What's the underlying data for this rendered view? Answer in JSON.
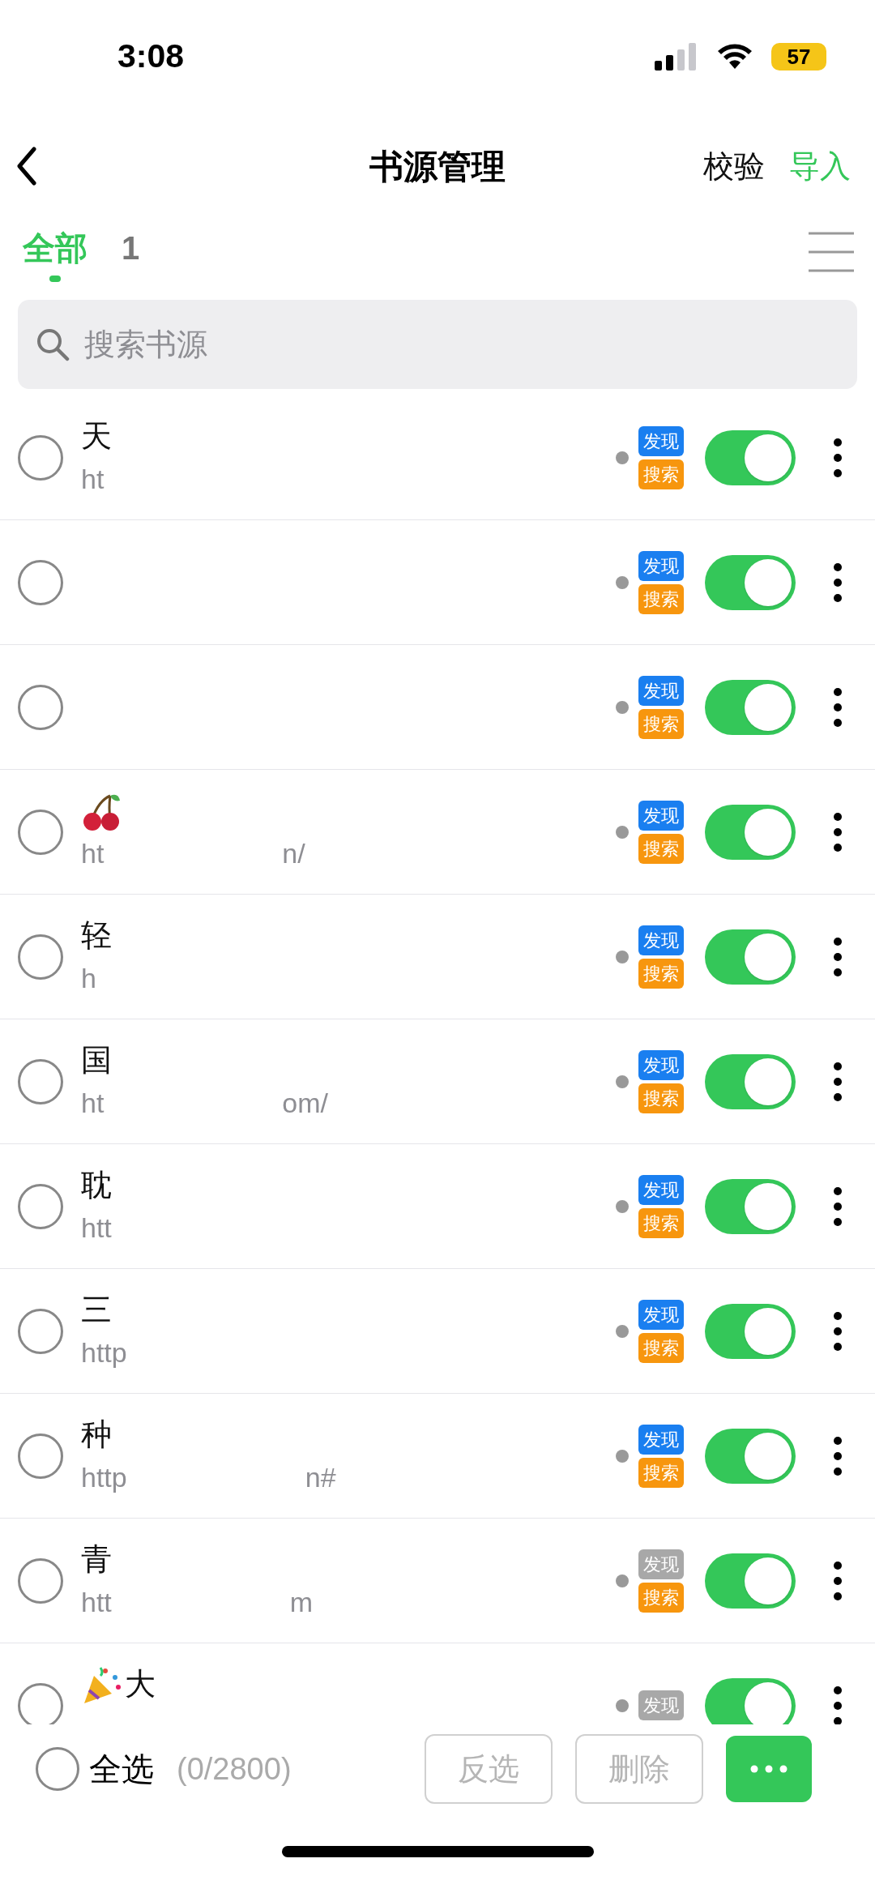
{
  "status_bar": {
    "time": "3:08",
    "battery": "57"
  },
  "nav": {
    "title": "书源管理",
    "actions": [
      {
        "label": "校验",
        "kind": "plain"
      },
      {
        "label": "导入",
        "kind": "accent"
      }
    ]
  },
  "tabs": [
    {
      "label": "全部",
      "selected": true
    },
    {
      "label": "1",
      "selected": false
    }
  ],
  "search": {
    "placeholder": "搜索书源"
  },
  "sources": [
    {
      "kind": "plain",
      "name": "天",
      "url": "ht",
      "checked": false,
      "discover_enabled": true,
      "discover": "发现",
      "search": "搜索",
      "on": true
    },
    {
      "kind": "plain",
      "checked": false,
      "discover_enabled": true,
      "discover": "发现",
      "search": "搜索",
      "on": true
    },
    {
      "kind": "plain",
      "checked": false,
      "discover_enabled": true,
      "discover": "发现",
      "search": "搜索",
      "on": true
    },
    {
      "kind": "cherry",
      "url": "ht",
      "url_tail": "n/",
      "checked": false,
      "discover_enabled": true,
      "discover": "发现",
      "search": "搜索",
      "on": true
    },
    {
      "kind": "plain",
      "name": "轻",
      "url": "h",
      "checked": false,
      "discover_enabled": true,
      "discover": "发现",
      "search": "搜索",
      "on": true
    },
    {
      "kind": "plain",
      "name": "国",
      "url": "ht",
      "url_tail": "om/",
      "checked": false,
      "discover_enabled": true,
      "discover": "发现",
      "search": "搜索",
      "on": true
    },
    {
      "kind": "plain",
      "name": "耽",
      "url": "htt",
      "checked": false,
      "discover_enabled": true,
      "discover": "发现",
      "search": "搜索",
      "on": true
    },
    {
      "kind": "plain",
      "name": "三",
      "url": "http",
      "checked": false,
      "discover_enabled": true,
      "discover": "发现",
      "search": "搜索",
      "on": true
    },
    {
      "kind": "plain",
      "name": "种",
      "url": "http",
      "url_tail": "n#",
      "checked": false,
      "discover_enabled": true,
      "discover": "发现",
      "search": "搜索",
      "on": true
    },
    {
      "kind": "plain",
      "name": "青",
      "url": "htt",
      "url_tail": "m",
      "checked": false,
      "discover_enabled": false,
      "discover": "发现",
      "search": "搜索",
      "on": true
    },
    {
      "kind": "popper",
      "name": "大",
      "checked": false,
      "discover_enabled": false,
      "discover": "发现",
      "on": true
    }
  ],
  "footer": {
    "select_all": {
      "label": "全选",
      "checked": false
    },
    "count": "(0/2800)",
    "buttons": [
      "反选",
      "删除"
    ]
  }
}
